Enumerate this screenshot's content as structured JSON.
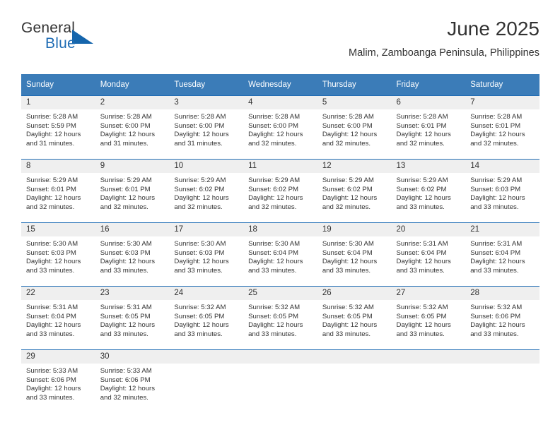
{
  "logo": {
    "word_one": "General",
    "word_two": "Blue",
    "triangle_color": "#1565ac",
    "blue_color": "#1f6cb4"
  },
  "header": {
    "title": "June 2025",
    "subtitle": "Malim, Zamboanga Peninsula, Philippines"
  },
  "theme": {
    "header_blue": "#3b7cb8",
    "rule_blue": "#1f6cb4",
    "daynum_gray": "#efefef",
    "text": "#333333"
  },
  "calendar": {
    "weekdays": [
      "Sunday",
      "Monday",
      "Tuesday",
      "Wednesday",
      "Thursday",
      "Friday",
      "Saturday"
    ],
    "weeks": [
      [
        {
          "day": "1",
          "sunrise": "Sunrise: 5:28 AM",
          "sunset": "Sunset: 5:59 PM",
          "daylight1": "Daylight: 12 hours",
          "daylight2": "and 31 minutes."
        },
        {
          "day": "2",
          "sunrise": "Sunrise: 5:28 AM",
          "sunset": "Sunset: 6:00 PM",
          "daylight1": "Daylight: 12 hours",
          "daylight2": "and 31 minutes."
        },
        {
          "day": "3",
          "sunrise": "Sunrise: 5:28 AM",
          "sunset": "Sunset: 6:00 PM",
          "daylight1": "Daylight: 12 hours",
          "daylight2": "and 31 minutes."
        },
        {
          "day": "4",
          "sunrise": "Sunrise: 5:28 AM",
          "sunset": "Sunset: 6:00 PM",
          "daylight1": "Daylight: 12 hours",
          "daylight2": "and 32 minutes."
        },
        {
          "day": "5",
          "sunrise": "Sunrise: 5:28 AM",
          "sunset": "Sunset: 6:00 PM",
          "daylight1": "Daylight: 12 hours",
          "daylight2": "and 32 minutes."
        },
        {
          "day": "6",
          "sunrise": "Sunrise: 5:28 AM",
          "sunset": "Sunset: 6:01 PM",
          "daylight1": "Daylight: 12 hours",
          "daylight2": "and 32 minutes."
        },
        {
          "day": "7",
          "sunrise": "Sunrise: 5:28 AM",
          "sunset": "Sunset: 6:01 PM",
          "daylight1": "Daylight: 12 hours",
          "daylight2": "and 32 minutes."
        }
      ],
      [
        {
          "day": "8",
          "sunrise": "Sunrise: 5:29 AM",
          "sunset": "Sunset: 6:01 PM",
          "daylight1": "Daylight: 12 hours",
          "daylight2": "and 32 minutes."
        },
        {
          "day": "9",
          "sunrise": "Sunrise: 5:29 AM",
          "sunset": "Sunset: 6:01 PM",
          "daylight1": "Daylight: 12 hours",
          "daylight2": "and 32 minutes."
        },
        {
          "day": "10",
          "sunrise": "Sunrise: 5:29 AM",
          "sunset": "Sunset: 6:02 PM",
          "daylight1": "Daylight: 12 hours",
          "daylight2": "and 32 minutes."
        },
        {
          "day": "11",
          "sunrise": "Sunrise: 5:29 AM",
          "sunset": "Sunset: 6:02 PM",
          "daylight1": "Daylight: 12 hours",
          "daylight2": "and 32 minutes."
        },
        {
          "day": "12",
          "sunrise": "Sunrise: 5:29 AM",
          "sunset": "Sunset: 6:02 PM",
          "daylight1": "Daylight: 12 hours",
          "daylight2": "and 32 minutes."
        },
        {
          "day": "13",
          "sunrise": "Sunrise: 5:29 AM",
          "sunset": "Sunset: 6:02 PM",
          "daylight1": "Daylight: 12 hours",
          "daylight2": "and 33 minutes."
        },
        {
          "day": "14",
          "sunrise": "Sunrise: 5:29 AM",
          "sunset": "Sunset: 6:03 PM",
          "daylight1": "Daylight: 12 hours",
          "daylight2": "and 33 minutes."
        }
      ],
      [
        {
          "day": "15",
          "sunrise": "Sunrise: 5:30 AM",
          "sunset": "Sunset: 6:03 PM",
          "daylight1": "Daylight: 12 hours",
          "daylight2": "and 33 minutes."
        },
        {
          "day": "16",
          "sunrise": "Sunrise: 5:30 AM",
          "sunset": "Sunset: 6:03 PM",
          "daylight1": "Daylight: 12 hours",
          "daylight2": "and 33 minutes."
        },
        {
          "day": "17",
          "sunrise": "Sunrise: 5:30 AM",
          "sunset": "Sunset: 6:03 PM",
          "daylight1": "Daylight: 12 hours",
          "daylight2": "and 33 minutes."
        },
        {
          "day": "18",
          "sunrise": "Sunrise: 5:30 AM",
          "sunset": "Sunset: 6:04 PM",
          "daylight1": "Daylight: 12 hours",
          "daylight2": "and 33 minutes."
        },
        {
          "day": "19",
          "sunrise": "Sunrise: 5:30 AM",
          "sunset": "Sunset: 6:04 PM",
          "daylight1": "Daylight: 12 hours",
          "daylight2": "and 33 minutes."
        },
        {
          "day": "20",
          "sunrise": "Sunrise: 5:31 AM",
          "sunset": "Sunset: 6:04 PM",
          "daylight1": "Daylight: 12 hours",
          "daylight2": "and 33 minutes."
        },
        {
          "day": "21",
          "sunrise": "Sunrise: 5:31 AM",
          "sunset": "Sunset: 6:04 PM",
          "daylight1": "Daylight: 12 hours",
          "daylight2": "and 33 minutes."
        }
      ],
      [
        {
          "day": "22",
          "sunrise": "Sunrise: 5:31 AM",
          "sunset": "Sunset: 6:04 PM",
          "daylight1": "Daylight: 12 hours",
          "daylight2": "and 33 minutes."
        },
        {
          "day": "23",
          "sunrise": "Sunrise: 5:31 AM",
          "sunset": "Sunset: 6:05 PM",
          "daylight1": "Daylight: 12 hours",
          "daylight2": "and 33 minutes."
        },
        {
          "day": "24",
          "sunrise": "Sunrise: 5:32 AM",
          "sunset": "Sunset: 6:05 PM",
          "daylight1": "Daylight: 12 hours",
          "daylight2": "and 33 minutes."
        },
        {
          "day": "25",
          "sunrise": "Sunrise: 5:32 AM",
          "sunset": "Sunset: 6:05 PM",
          "daylight1": "Daylight: 12 hours",
          "daylight2": "and 33 minutes."
        },
        {
          "day": "26",
          "sunrise": "Sunrise: 5:32 AM",
          "sunset": "Sunset: 6:05 PM",
          "daylight1": "Daylight: 12 hours",
          "daylight2": "and 33 minutes."
        },
        {
          "day": "27",
          "sunrise": "Sunrise: 5:32 AM",
          "sunset": "Sunset: 6:05 PM",
          "daylight1": "Daylight: 12 hours",
          "daylight2": "and 33 minutes."
        },
        {
          "day": "28",
          "sunrise": "Sunrise: 5:32 AM",
          "sunset": "Sunset: 6:06 PM",
          "daylight1": "Daylight: 12 hours",
          "daylight2": "and 33 minutes."
        }
      ],
      [
        {
          "day": "29",
          "sunrise": "Sunrise: 5:33 AM",
          "sunset": "Sunset: 6:06 PM",
          "daylight1": "Daylight: 12 hours",
          "daylight2": "and 33 minutes."
        },
        {
          "day": "30",
          "sunrise": "Sunrise: 5:33 AM",
          "sunset": "Sunset: 6:06 PM",
          "daylight1": "Daylight: 12 hours",
          "daylight2": "and 32 minutes."
        },
        {
          "day": "",
          "sunrise": "",
          "sunset": "",
          "daylight1": "",
          "daylight2": ""
        },
        {
          "day": "",
          "sunrise": "",
          "sunset": "",
          "daylight1": "",
          "daylight2": ""
        },
        {
          "day": "",
          "sunrise": "",
          "sunset": "",
          "daylight1": "",
          "daylight2": ""
        },
        {
          "day": "",
          "sunrise": "",
          "sunset": "",
          "daylight1": "",
          "daylight2": ""
        },
        {
          "day": "",
          "sunrise": "",
          "sunset": "",
          "daylight1": "",
          "daylight2": ""
        }
      ]
    ]
  }
}
